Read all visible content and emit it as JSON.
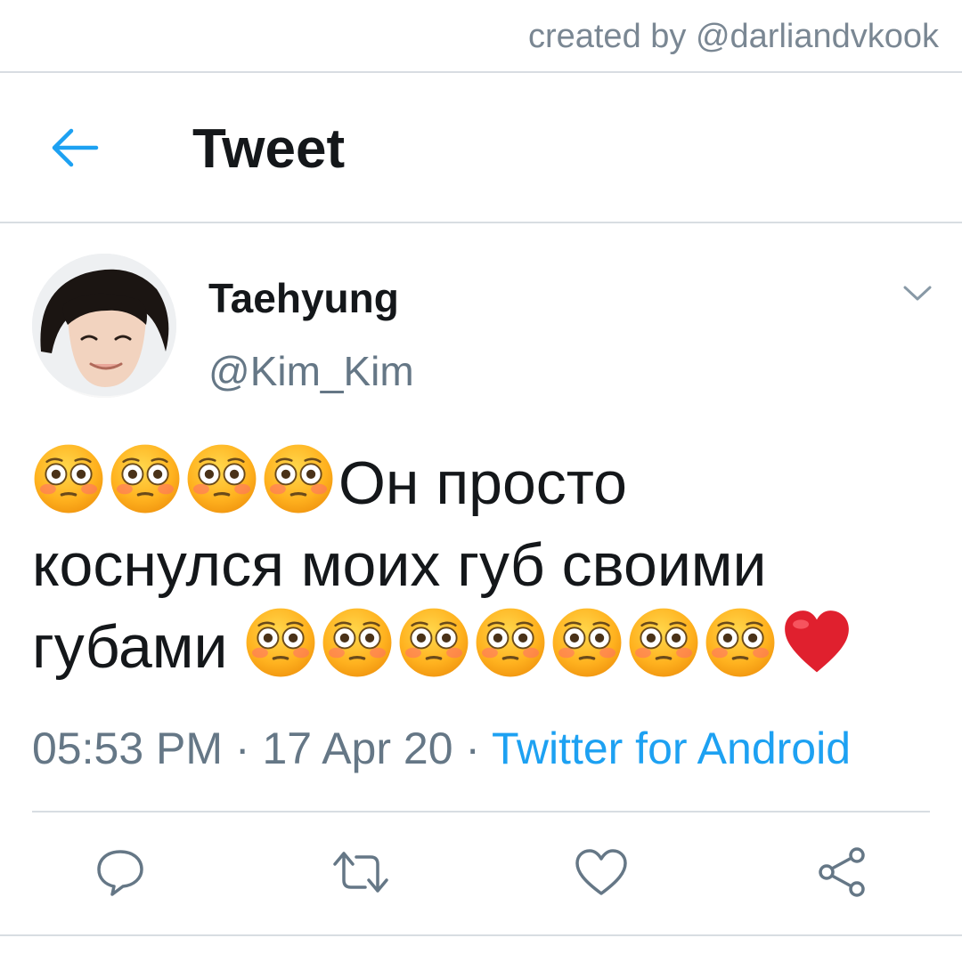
{
  "credit": "created by @darliandvkook",
  "header": {
    "title": "Tweet"
  },
  "tweet": {
    "display_name": "Taehyung",
    "handle": "@Kim_Kim",
    "text_lines": [
      "Он просто",
      "коснулся моих губ своими",
      "губами "
    ],
    "timestamp": "05:53 PM · 17 Apr 20 · ",
    "source": "Twitter for Android"
  },
  "icons": {
    "back": "back-arrow-icon",
    "caret": "chevron-down-icon",
    "reply": "reply-icon",
    "retweet": "retweet-icon",
    "like": "heart-icon",
    "share": "share-icon",
    "emoji": "flushed-face-emoji",
    "heart_emoji": "red-heart-emoji"
  },
  "colors": {
    "accent": "#1da1f2",
    "muted": "#657786",
    "text": "#14171a",
    "divider": "#d8dde2"
  }
}
